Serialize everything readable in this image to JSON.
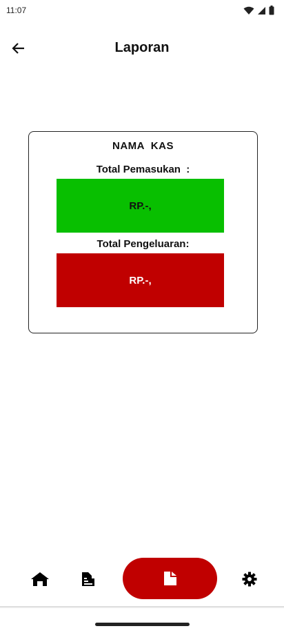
{
  "status_bar": {
    "time": "11:07"
  },
  "header": {
    "title": "Laporan"
  },
  "card": {
    "kas_name": "NAMA  KAS",
    "income_label": "Total Pemasukan  :",
    "income_value": "RP.-,",
    "expense_label": "Total Pengeluaran:",
    "expense_value": "RP.-,"
  },
  "colors": {
    "income": "#08bf00",
    "expense": "#c00000",
    "active_nav": "#c00000"
  },
  "bottom_nav": {
    "items": [
      {
        "icon": "home-icon",
        "active": false
      },
      {
        "icon": "list-document-icon",
        "active": false
      },
      {
        "icon": "report-document-icon",
        "active": true
      },
      {
        "icon": "gear-icon",
        "active": false
      }
    ]
  }
}
